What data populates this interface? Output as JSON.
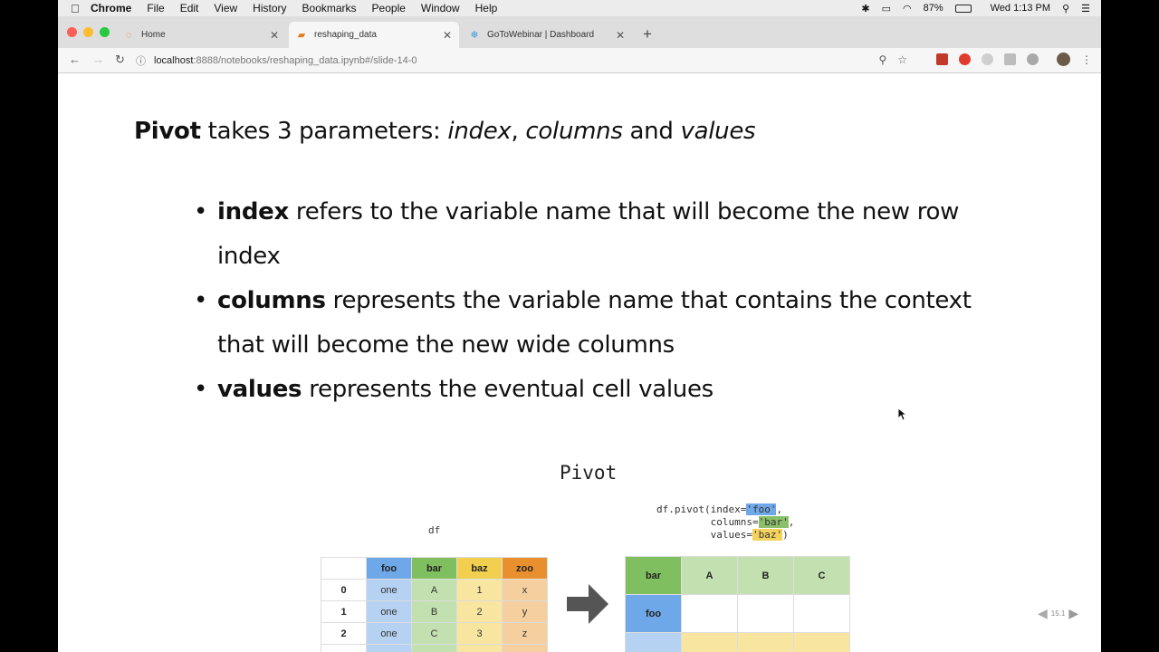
{
  "menubar": {
    "apple": "",
    "items": [
      "Chrome",
      "File",
      "Edit",
      "View",
      "History",
      "Bookmarks",
      "People",
      "Window",
      "Help"
    ],
    "battery": "87%",
    "clock": "Wed 1:13 PM"
  },
  "tabs": [
    {
      "title": "Home",
      "icon": "jupyter-icon"
    },
    {
      "title": "reshaping_data",
      "icon": "notebook-icon"
    },
    {
      "title": "GoToWebinar | Dashboard",
      "icon": "gotowebinar-icon"
    }
  ],
  "address": {
    "host": "localhost",
    "path": ":8888/notebooks/reshaping_data.ipynb#/slide-14-0"
  },
  "slide": {
    "headline": {
      "bold": "Pivot",
      "text1": " takes 3 parameters: ",
      "p1": "index",
      "sep1": ", ",
      "p2": "columns",
      "sep2": " and ",
      "p3": "values"
    },
    "bullets": [
      {
        "term": "index",
        "desc": " refers to the variable name that will become the new row index"
      },
      {
        "term": "columns",
        "desc": " represents the variable name that contains the context that will become the new wide columns"
      },
      {
        "term": "values",
        "desc": " represents the eventual cell values"
      }
    ],
    "diagram": {
      "title": "Pivot",
      "df_label": "df",
      "code": {
        "line1_pre": "df.pivot(index=",
        "line1_hl": "'foo'",
        "line1_post": ",",
        "line2_pre": "         columns=",
        "line2_hl": "'bar'",
        "line2_post": ",",
        "line3_pre": "         values=",
        "line3_hl": "'baz'",
        "line3_post": ")"
      },
      "source_table": {
        "headers": [
          "",
          "foo",
          "bar",
          "baz",
          "zoo"
        ],
        "rows": [
          [
            "0",
            "one",
            "A",
            "1",
            "x"
          ],
          [
            "1",
            "one",
            "B",
            "2",
            "y"
          ],
          [
            "2",
            "one",
            "C",
            "3",
            "z"
          ]
        ]
      },
      "result_table": {
        "corner": "bar",
        "columns": [
          "A",
          "B",
          "C"
        ],
        "index_label": "foo"
      }
    },
    "page_indicator": "15.1"
  },
  "colors": {
    "foo_header": "#6fa8e8",
    "foo_cell": "#b6d2f2",
    "bar_header": "#7fbf5f",
    "bar_cell": "#c3e1b0",
    "baz_header": "#f2cf4f",
    "baz_cell": "#f8e6a0",
    "zoo_header": "#e9902e",
    "zoo_cell": "#f5cf9d"
  }
}
